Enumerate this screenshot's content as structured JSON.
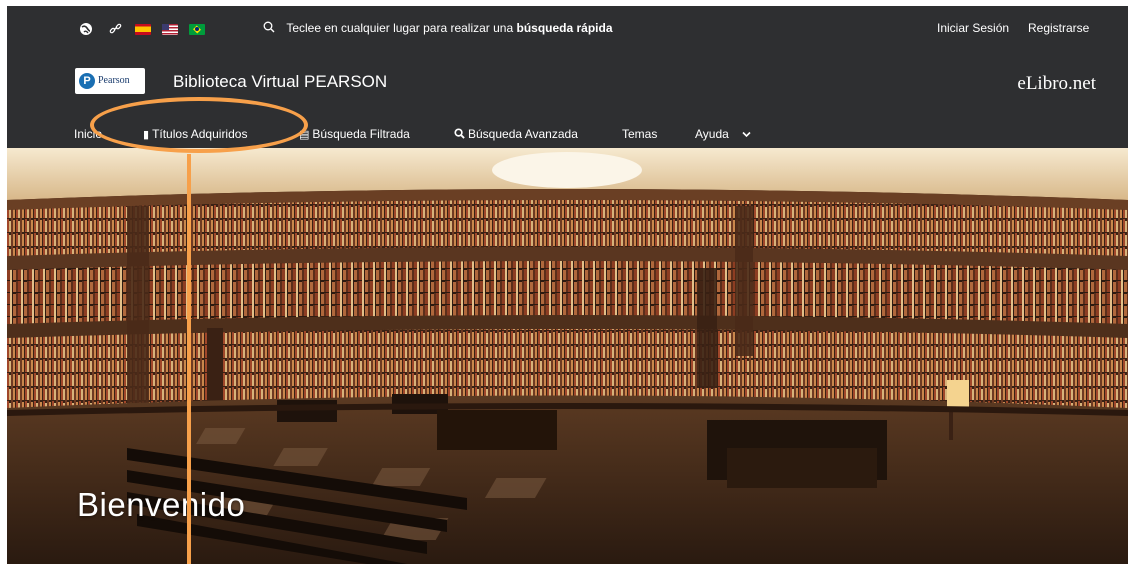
{
  "topbar": {
    "search_prefix": "Teclee en cualquier lugar para realizar una ",
    "search_bold": "búsqueda rápida",
    "login": "Iniciar Sesión",
    "register": "Registrarse",
    "icons": [
      "globe-icon",
      "link-icon",
      "flag-spain-icon",
      "flag-usa-icon",
      "flag-brazil-icon",
      "search-icon"
    ]
  },
  "brand": {
    "logo_text": "Pearson",
    "logo_letter": "P",
    "title": "Biblioteca Virtual PEARSON",
    "site": "eLibro.net"
  },
  "nav": {
    "items": [
      "Inicio",
      "Títulos Adquiridos",
      "Búsqueda Filtrada",
      "Búsqueda Avanzada",
      "Temas",
      "Ayuda"
    ]
  },
  "hero": {
    "welcome": "Bienvenido"
  },
  "colors": {
    "header_bg": "#2e2f31",
    "annotation": "#f7a04a",
    "text": "#ffffff"
  }
}
